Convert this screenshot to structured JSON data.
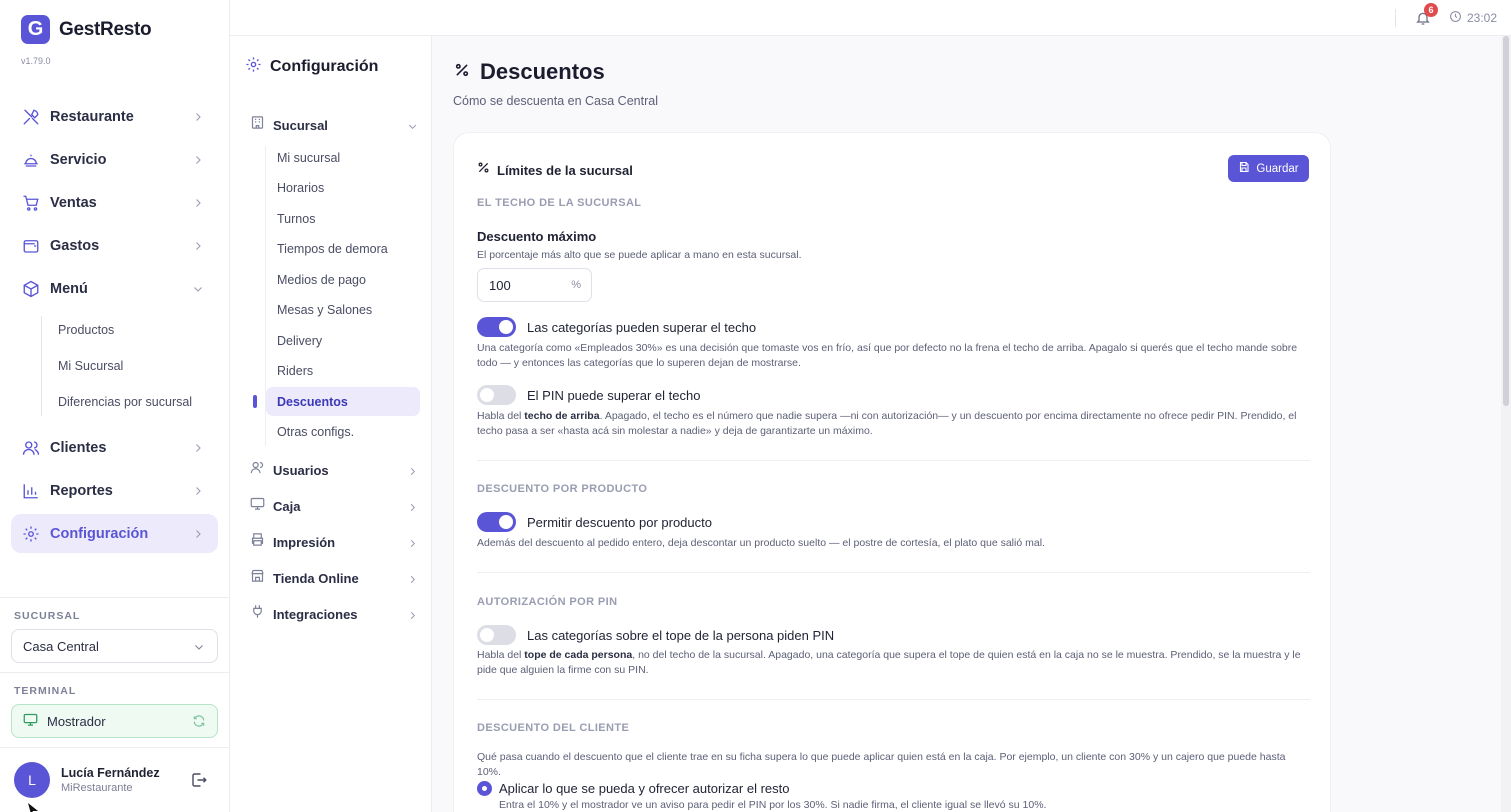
{
  "app": {
    "name": "GestResto",
    "logo_letter": "G",
    "version": "v1.79.0",
    "accent": "#5a55d6"
  },
  "sidebar": {
    "items": [
      {
        "label": "Restaurante",
        "icon": "utensils-icon"
      },
      {
        "label": "Servicio",
        "icon": "cloche-icon"
      },
      {
        "label": "Ventas",
        "icon": "cart-icon"
      },
      {
        "label": "Gastos",
        "icon": "wallet-icon"
      },
      {
        "label": "Menú",
        "icon": "box-icon",
        "expanded": true
      },
      {
        "label": "Clientes",
        "icon": "users-icon"
      },
      {
        "label": "Reportes",
        "icon": "bar-chart-icon"
      },
      {
        "label": "Configuración",
        "icon": "gear-icon",
        "active": true
      }
    ],
    "menu_sub": [
      "Productos",
      "Mi Sucursal",
      "Diferencias por sucursal"
    ],
    "branch_caption": "SUCURSAL",
    "branch_value": "Casa Central",
    "terminal_caption": "TERMINAL",
    "terminal_value": "Mostrador",
    "user": {
      "initial": "L",
      "name": "Lucía Fernández",
      "org": "MiRestaurante"
    }
  },
  "config_nav": {
    "title": "Configuración",
    "groups": [
      {
        "label": "Sucursal",
        "icon": "building-icon",
        "expanded": true
      },
      {
        "label": "Usuarios",
        "icon": "users-icon"
      },
      {
        "label": "Caja",
        "icon": "monitor-icon"
      },
      {
        "label": "Impresión",
        "icon": "printer-icon"
      },
      {
        "label": "Tienda Online",
        "icon": "store-icon"
      },
      {
        "label": "Integraciones",
        "icon": "plug-icon"
      }
    ],
    "sucursal_items": [
      "Mi sucursal",
      "Horarios",
      "Turnos",
      "Tiempos de demora",
      "Medios de pago",
      "Mesas y Salones",
      "Delivery",
      "Riders",
      "Descuentos",
      "Otras configs."
    ],
    "active_item": "Descuentos"
  },
  "topbar": {
    "notifications": "6",
    "time": "23:02"
  },
  "page": {
    "title": "Descuentos",
    "subtitle": "Cómo se descuenta en Casa Central",
    "card": {
      "title": "Límites de la sucursal",
      "save_label": "Guardar",
      "sec1": {
        "caption": "EL TECHO DE LA SUCURSAL",
        "max_label": "Descuento máximo",
        "max_help": "El porcentaje más alto que se puede aplicar a mano en esta sucursal.",
        "max_value": "100",
        "max_unit": "%",
        "toggle1_label": "Las categorías pueden superar el techo",
        "toggle1_on": true,
        "toggle1_help": "Una categoría como «Empleados 30%» es una decisión que tomaste vos en frío, así que por defecto no la frena el techo de arriba. Apagalo si querés que el techo mande sobre todo — y entonces las categorías que lo superen dejan de mostrarse.",
        "toggle2_label": "El PIN puede superar el techo",
        "toggle2_on": false,
        "toggle2_help_a": "Habla del ",
        "toggle2_help_b": "techo de arriba",
        "toggle2_help_c": ". Apagado, el techo es el número que nadie supera —ni con autorización— y un descuento por encima directamente no ofrece pedir PIN. Prendido, el techo pasa a ser «hasta acá sin molestar a nadie» y deja de garantizarte un máximo."
      },
      "sec2": {
        "caption": "DESCUENTO POR PRODUCTO",
        "toggle_label": "Permitir descuento por producto",
        "toggle_on": true,
        "help": "Además del descuento al pedido entero, deja descontar un producto suelto — el postre de cortesía, el plato que salió mal."
      },
      "sec3": {
        "caption": "AUTORIZACIÓN POR PIN",
        "toggle_label": "Las categorías sobre el tope de la persona piden PIN",
        "toggle_on": false,
        "help_a": "Habla del ",
        "help_b": "tope de cada persona",
        "help_c": ", no del techo de la sucursal. Apagado, una categoría que supera el tope de quien está en la caja no se le muestra. Prendido, se la muestra y le pide que alguien la firme con su PIN."
      },
      "sec4": {
        "caption": "DESCUENTO DEL CLIENTE",
        "help": "Qué pasa cuando el descuento que el cliente trae en su ficha supera lo que puede aplicar quien está en la caja. Por ejemplo, un cliente con 30% y un cajero que puede hasta 10%.",
        "radio_label": "Aplicar lo que se pueda y ofrecer autorizar el resto",
        "radio_help": "Entra el 10% y el mostrador ve un aviso para pedir el PIN por los 30%. Si nadie firma, el cliente igual se llevó su 10%."
      }
    }
  }
}
